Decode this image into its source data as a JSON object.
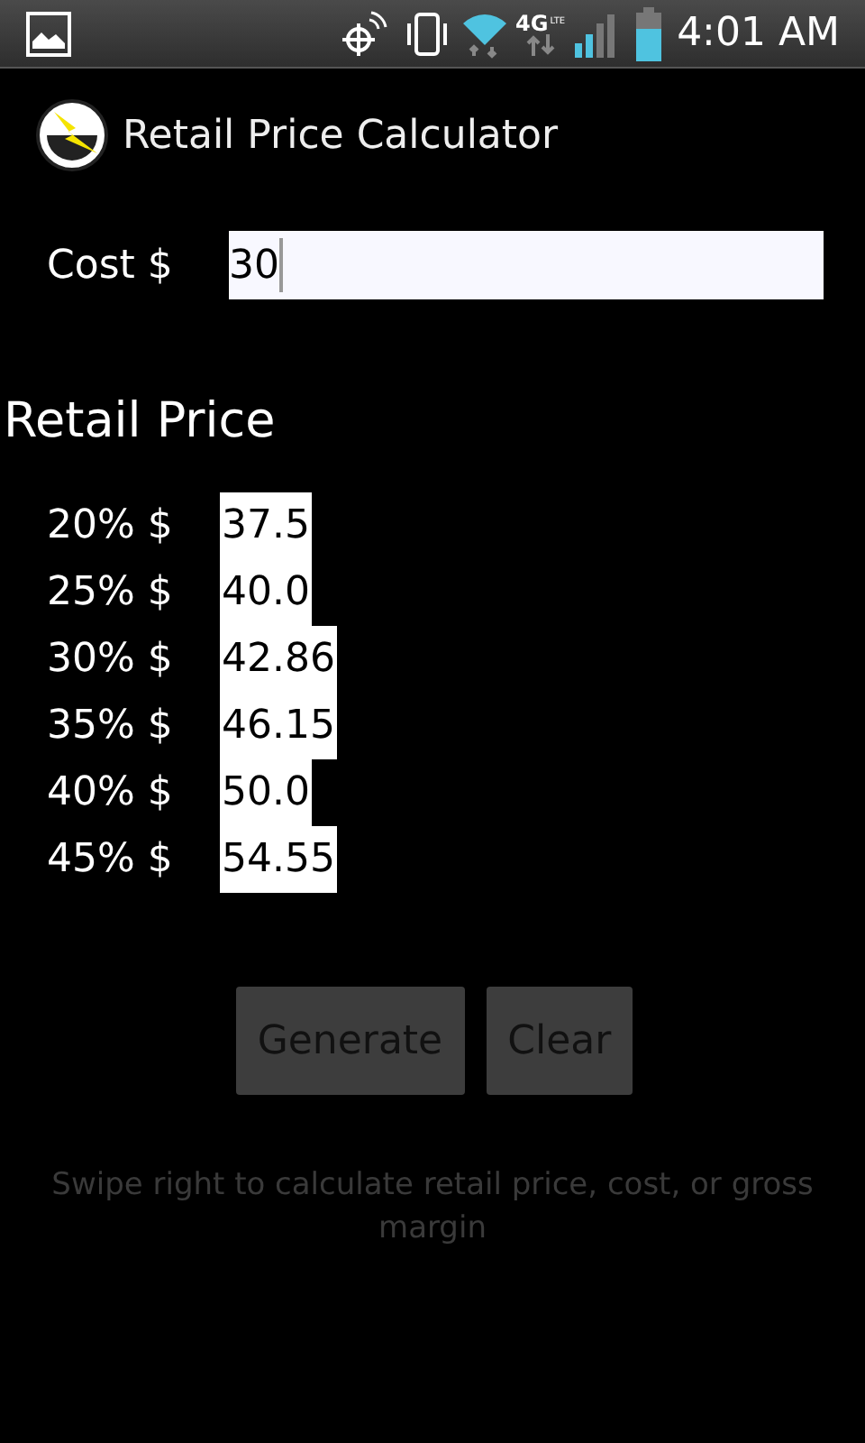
{
  "status_bar": {
    "network_type": "4G",
    "network_sub": "LTE",
    "time": "4:01 AM"
  },
  "title_bar": {
    "title": "Retail Price Calculator"
  },
  "cost": {
    "label": "Cost $",
    "value": "30"
  },
  "results": {
    "heading": "Retail Price",
    "rows": [
      {
        "label": "20% $",
        "value": "37.5"
      },
      {
        "label": "25% $",
        "value": "40.0"
      },
      {
        "label": "30% $",
        "value": "42.86"
      },
      {
        "label": "35% $",
        "value": "46.15"
      },
      {
        "label": "40% $",
        "value": "50.0"
      },
      {
        "label": "45% $",
        "value": "54.55"
      }
    ]
  },
  "buttons": [
    "Generate",
    "Clear"
  ],
  "hint": "Swipe right to calculate retail price, cost, or gross margin"
}
